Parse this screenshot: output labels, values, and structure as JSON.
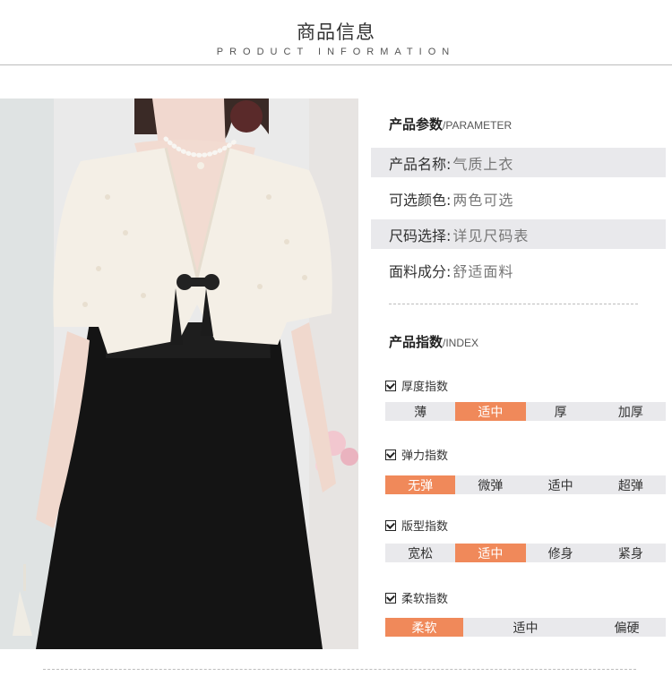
{
  "header": {
    "title_cn": "商品信息",
    "title_en": "PRODUCT INFORMATION"
  },
  "params": {
    "title": "产品参数",
    "title_en": "/PARAMETER",
    "rows": [
      {
        "label": "产品名称:",
        "value": "气质上衣"
      },
      {
        "label": "可选颜色:",
        "value": "两色可选"
      },
      {
        "label": "尺码选择:",
        "value": "详见尺码表"
      },
      {
        "label": "面料成分:",
        "value": "舒适面料"
      }
    ]
  },
  "index": {
    "title": "产品指数",
    "title_en": "/INDEX",
    "groups": [
      {
        "name": "厚度指数",
        "options": [
          "薄",
          "适中",
          "厚",
          "加厚"
        ],
        "selected": 1
      },
      {
        "name": "弹力指数",
        "options": [
          "无弹",
          "微弹",
          "适中",
          "超弹"
        ],
        "selected": 0
      },
      {
        "name": "版型指数",
        "options": [
          "宽松",
          "适中",
          "修身",
          "紧身"
        ],
        "selected": 1
      },
      {
        "name": "柔软指数",
        "options": [
          "柔软",
          "适中",
          "偏硬"
        ],
        "selected": 0
      }
    ]
  },
  "colors": {
    "accent": "#f0895a",
    "bar": "#e9e9ec",
    "garment_top": "#f4efe6",
    "garment_skirt": "#141414"
  },
  "photo": {
    "icon": "product-photo"
  }
}
